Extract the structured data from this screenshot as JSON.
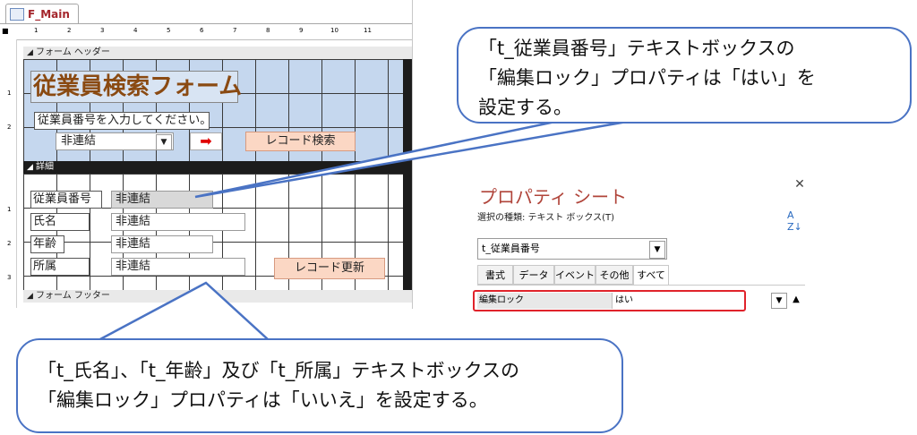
{
  "designer": {
    "tab_label": "F_Main",
    "ruler_marks": [
      "1",
      "2",
      "3",
      "4",
      "5",
      "6",
      "7",
      "8",
      "9",
      "10",
      "11"
    ],
    "vruler_header": [
      "1",
      "2"
    ],
    "vruler_detail": [
      "1",
      "2",
      "3"
    ],
    "sections": {
      "header": "フォーム ヘッダー",
      "detail": "詳細",
      "footer": "フォーム フッター"
    },
    "title": "従業員検索フォーム",
    "prompt": "従業員番号を入力してください。",
    "combo_value": "非連結",
    "search_button": "レコード検索",
    "fields": [
      {
        "label": "従業員番号",
        "value": "非連結"
      },
      {
        "label": "氏名",
        "value": "非連結"
      },
      {
        "label": "年齢",
        "value": "非連結"
      },
      {
        "label": "所属",
        "value": "非連結"
      }
    ],
    "update_button": "レコード更新"
  },
  "property_sheet": {
    "title": "プロパティ シート",
    "selection_type": "選択の種類: テキスト ボックス(T)",
    "selected_control": "t_従業員番号",
    "tabs": [
      "書式",
      "データ",
      "イベント",
      "その他",
      "すべて"
    ],
    "active_tab": "すべて",
    "property_name": "編集ロック",
    "property_value": "はい"
  },
  "callouts": {
    "top": [
      "「t_従業員番号」テキストボックスの",
      "「編集ロック」プロパティは「はい」を",
      "設定する。"
    ],
    "bottom": [
      "「t_氏名」、「t_年齢」及び「t_所属」テキストボックスの",
      "「編集ロック」プロパティは「いいえ」を設定する。"
    ]
  },
  "colors": {
    "callout_border": "#4a73c4",
    "highlight": "#e0232b",
    "header_bg": "#c5d7ee",
    "title_text": "#8a4a12",
    "button_bg": "#fbd7c4",
    "props_title": "#b0443a"
  }
}
